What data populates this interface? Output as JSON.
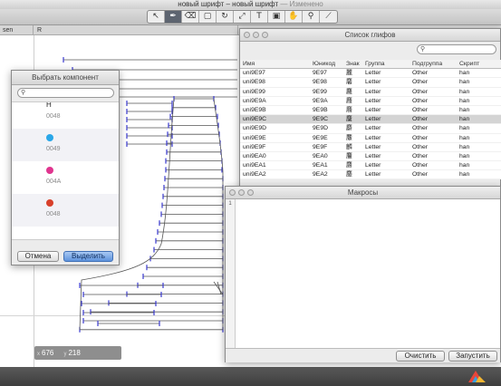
{
  "window": {
    "title": "новый шрифт – новый шрифт",
    "title_state": "— Изменено"
  },
  "toolbar": {
    "tools": [
      {
        "icon": "pointer-icon",
        "glyph": "↖",
        "active": false
      },
      {
        "icon": "pen-icon",
        "glyph": "✒",
        "active": true
      },
      {
        "icon": "eraser-icon",
        "glyph": "⌫",
        "active": false
      },
      {
        "icon": "rectangle-icon",
        "glyph": "▢",
        "active": false
      },
      {
        "icon": "rotate-icon",
        "glyph": "↻",
        "active": false
      },
      {
        "icon": "scale-icon",
        "glyph": "⤢",
        "active": false
      },
      {
        "icon": "text-icon",
        "glyph": "T",
        "active": false
      },
      {
        "icon": "image-icon",
        "glyph": "▣",
        "active": false
      },
      {
        "icon": "hand-icon",
        "glyph": "✋",
        "active": false
      },
      {
        "icon": "zoom-icon",
        "glyph": "⚲",
        "active": false
      },
      {
        "icon": "ruler-icon",
        "glyph": "⟋",
        "active": false
      }
    ]
  },
  "tabs": [
    {
      "label": "sen"
    },
    {
      "label": "R"
    }
  ],
  "status": {
    "x_label": "x",
    "x_value": "676",
    "y_label": "y",
    "y_value": "218"
  },
  "glyph_list": {
    "title": "Список глифов",
    "columns": [
      "Имя",
      "Юникод",
      "Знак",
      "Группа",
      "Подгруппа",
      "Скрипт"
    ],
    "selected_index": 5,
    "rows": [
      [
        "uni9E97",
        "9E97",
        "麗",
        "Letter",
        "Other",
        "han"
      ],
      [
        "uni9E98",
        "9E98",
        "麘",
        "Letter",
        "Other",
        "han"
      ],
      [
        "uni9E99",
        "9E99",
        "麙",
        "Letter",
        "Other",
        "han"
      ],
      [
        "uni9E9A",
        "9E9A",
        "麚",
        "Letter",
        "Other",
        "han"
      ],
      [
        "uni9E9B",
        "9E9B",
        "麛",
        "Letter",
        "Other",
        "han"
      ],
      [
        "uni9E9C",
        "9E9C",
        "麜",
        "Letter",
        "Other",
        "han"
      ],
      [
        "uni9E9D",
        "9E9D",
        "麝",
        "Letter",
        "Other",
        "han"
      ],
      [
        "uni9E9E",
        "9E9E",
        "麞",
        "Letter",
        "Other",
        "han"
      ],
      [
        "uni9E9F",
        "9E9F",
        "麟",
        "Letter",
        "Other",
        "han"
      ],
      [
        "uni9EA0",
        "9EA0",
        "麠",
        "Letter",
        "Other",
        "han"
      ],
      [
        "uni9EA1",
        "9EA1",
        "麡",
        "Letter",
        "Other",
        "han"
      ],
      [
        "uni9EA2",
        "9EA2",
        "麢",
        "Letter",
        "Other",
        "han"
      ]
    ]
  },
  "macro": {
    "title": "Макросы",
    "line_number": "1",
    "clear_label": "Очистить",
    "run_label": "Запустить"
  },
  "component_picker": {
    "title": "Выбрать компонент",
    "items": [
      {
        "symbol": "H",
        "code": "0048",
        "color": ""
      },
      {
        "symbol": "",
        "code": "0049",
        "color": "#2aa7e8"
      },
      {
        "symbol": "",
        "code": "004A",
        "color": "#e0358f"
      },
      {
        "symbol": "",
        "code": "0048",
        "color": "#d8402a"
      }
    ],
    "cancel_label": "Отмена",
    "select_label": "Выделить"
  }
}
